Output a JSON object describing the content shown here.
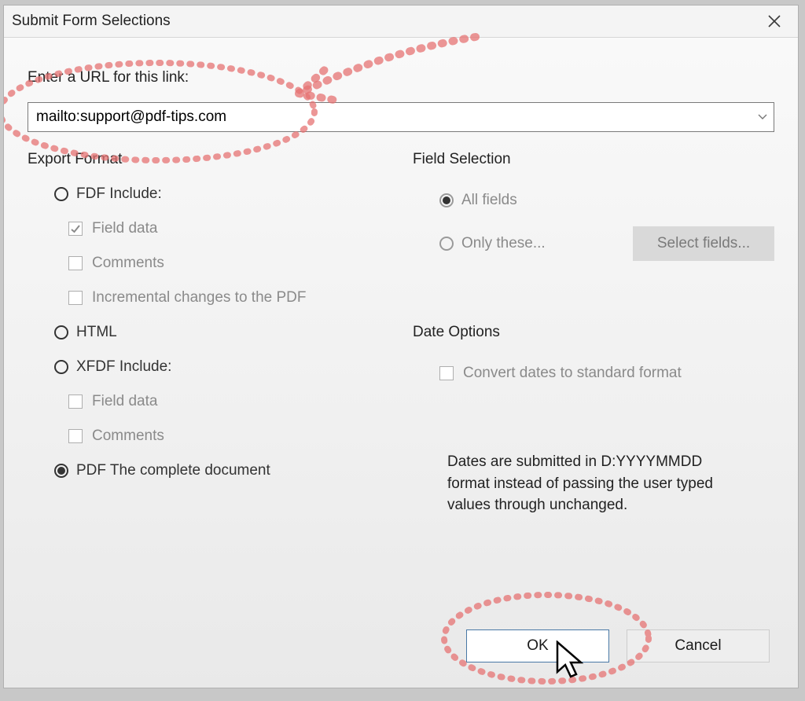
{
  "dialog": {
    "title": "Submit Form Selections",
    "url_label": "Enter a URL for this link:",
    "url_value": "mailto:support@pdf-tips.com"
  },
  "export_format": {
    "title": "Export Format",
    "fdf_label": "FDF  Include:",
    "fdf_field_data": "Field data",
    "fdf_comments": "Comments",
    "fdf_incremental": "Incremental changes to the PDF",
    "html_label": "HTML",
    "xfdf_label": "XFDF  Include:",
    "xfdf_field_data": "Field data",
    "xfdf_comments": "Comments",
    "pdf_label": "PDF  The complete document"
  },
  "field_selection": {
    "title": "Field Selection",
    "all_fields": "All fields",
    "only_these": "Only these...",
    "select_button": "Select fields..."
  },
  "date_options": {
    "title": "Date Options",
    "convert_label": "Convert dates to standard format",
    "help": "Dates are submitted in D:YYYYMMDD format instead of passing the user typed values through unchanged."
  },
  "buttons": {
    "ok": "OK",
    "cancel": "Cancel"
  }
}
